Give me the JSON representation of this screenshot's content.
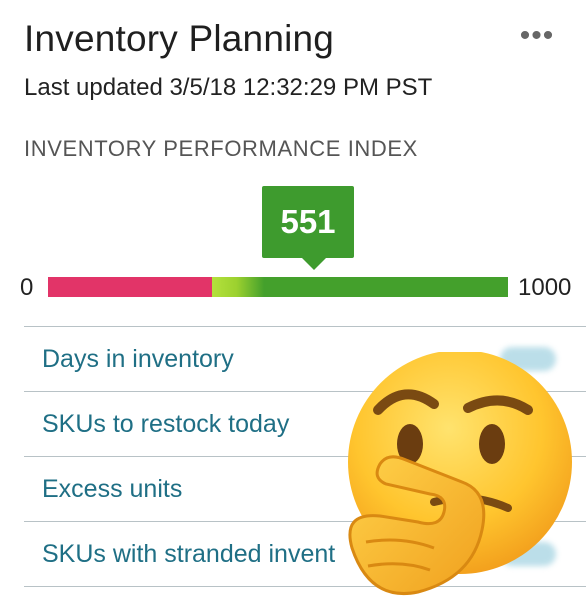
{
  "header": {
    "title": "Inventory Planning",
    "more_label": "•••",
    "last_updated": "Last updated 3/5/18 12:32:29 PM PST"
  },
  "gauge": {
    "section_title": "INVENTORY PERFORMANCE INDEX",
    "min_label": "0",
    "max_label": "1000",
    "score": 551,
    "score_label": "551",
    "colors": {
      "poor": "#e23468",
      "fair": "#b4e13c",
      "good": "#44a02c",
      "marker": "#3e9b2e"
    }
  },
  "metrics": [
    {
      "label": "Days in inventory"
    },
    {
      "label": "SKUs to restock today"
    },
    {
      "label": "Excess units"
    },
    {
      "label": "SKUs with stranded inventory",
      "visible_label": "SKUs with stranded invent"
    }
  ],
  "overlay": {
    "icon": "thinking-face-emoji-icon"
  }
}
